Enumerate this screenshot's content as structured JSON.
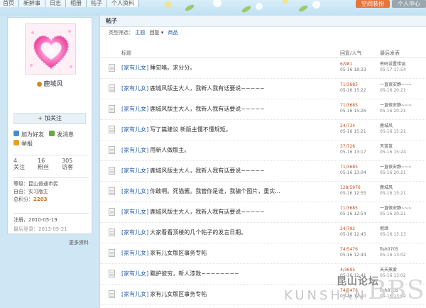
{
  "nav": {
    "items": [
      "首页",
      "新鲜事",
      "日志",
      "相册",
      "帖子",
      "个人资料"
    ]
  },
  "top_buttons": {
    "left": "空间装扮",
    "right": "个人中心"
  },
  "profile": {
    "name": "鹿城风",
    "follow_label": "加关注",
    "add_friend": "加为好友",
    "send_message": "发消息",
    "report": "举报",
    "stats": [
      {
        "value": "4",
        "label": "关注"
      },
      {
        "value": "16",
        "label": "粉丝"
      },
      {
        "value": "305",
        "label": "访客"
      }
    ],
    "level": "等级：昆山普通市民",
    "title_line": "自由：实习版主",
    "points_label": "总积分：",
    "points_value": "2203",
    "registered": "注册，2010-05-19",
    "last_login": "最后登录：2013-05-21",
    "more": "更多资料"
  },
  "main": {
    "tab": "帖子",
    "filter": {
      "label": "类型筛选：",
      "topic": "主题",
      "reply": "回复",
      "product": "商品"
    },
    "headers": {
      "title": "标题",
      "stats": "回复/人气",
      "last": "最后发表"
    },
    "rows": [
      {
        "cat": "[家有儿女]",
        "title": "睡觉咯。求分分。",
        "stats": "6/981",
        "date": "05-16 18:33",
        "user": "密码设置错误",
        "time": "05-17 17:54"
      },
      {
        "cat": "[家有儿女]",
        "title": "鹿城风版主大人，我新人我有话要说~~~~~",
        "stats": "71/3685",
        "date": "05-16 15:22",
        "user": "一直很安静~~~",
        "time": "05-16 20:21"
      },
      {
        "cat": "[家有儿女]",
        "title": "鹿城风版主大人，我新人我有话要说~~~~~",
        "stats": "71/3685",
        "date": "05-16 15:26",
        "user": "一直很安静~~~",
        "time": "05-16 20:21"
      },
      {
        "cat": "[家有儿女]",
        "title": "写了篇建议 新版主懂不懂规矩。",
        "stats": "24/734",
        "date": "05-16 15:21",
        "user": "鹿城风",
        "time": "05-16 15:21"
      },
      {
        "cat": "[家有儿女]",
        "title": "用新人做版主。",
        "stats": "37/726",
        "date": "05-16 13:17",
        "user": "天蓝蓝",
        "time": "05-16 15:24"
      },
      {
        "cat": "[家有儿女]",
        "title": "鹿城风版主大人，我新人我有话要说~~~~~",
        "stats": "71/3685",
        "date": "05-16 13:04",
        "user": "一直很安静~~~",
        "time": "05-16 20:21"
      },
      {
        "cat": "[家有儿女]",
        "title": "你敢啊。死猫酱。我管你是谁，我骗个图片，重实...",
        "stats": "128/5976",
        "date": "05-16 12:55",
        "user": "鹿城风",
        "time": "05-16 15:21"
      },
      {
        "cat": "[家有儿女]",
        "title": "鹿城风版主大人，我新人我有话要说~~~~~",
        "stats": "71/3685",
        "date": "05-16 12:54",
        "user": "一直很安静~~~",
        "time": "05-16 20:21"
      },
      {
        "cat": "[家有儿女]",
        "title": "大家看看顶楼的几个帖子的发言日期。",
        "stats": "24/792",
        "date": "05-16 12:45",
        "user": "假酒",
        "time": "05-16 15:13"
      },
      {
        "cat": "[家有儿女]",
        "title": "家有儿女版区事务专帖",
        "stats": "74/5476",
        "date": "05-16 12:44",
        "user": "fish0705",
        "time": "05-16 13:02"
      },
      {
        "cat": "[家有儿女]",
        "title": "黯护彼穷，新人漆救~~~~~~~~",
        "stats": "4/3695",
        "date": "05-16 12:41",
        "user": "天天蒸爱",
        "time": "05-16 13:02"
      },
      {
        "cat": "[家有儿女]",
        "title": "家有儿女版区事务专帖",
        "stats": "74/5476",
        "date": "05-16 12:40",
        "user": "fish0705",
        "time": "05-16 13:02"
      }
    ]
  },
  "watermark": {
    "cn": "昆山论坛",
    "en": "KUNSHAN",
    "bbs": "BBS"
  },
  "colors": {
    "accent": "#2a5fa8",
    "orange": "#e8743a",
    "points": "#d2691e"
  }
}
